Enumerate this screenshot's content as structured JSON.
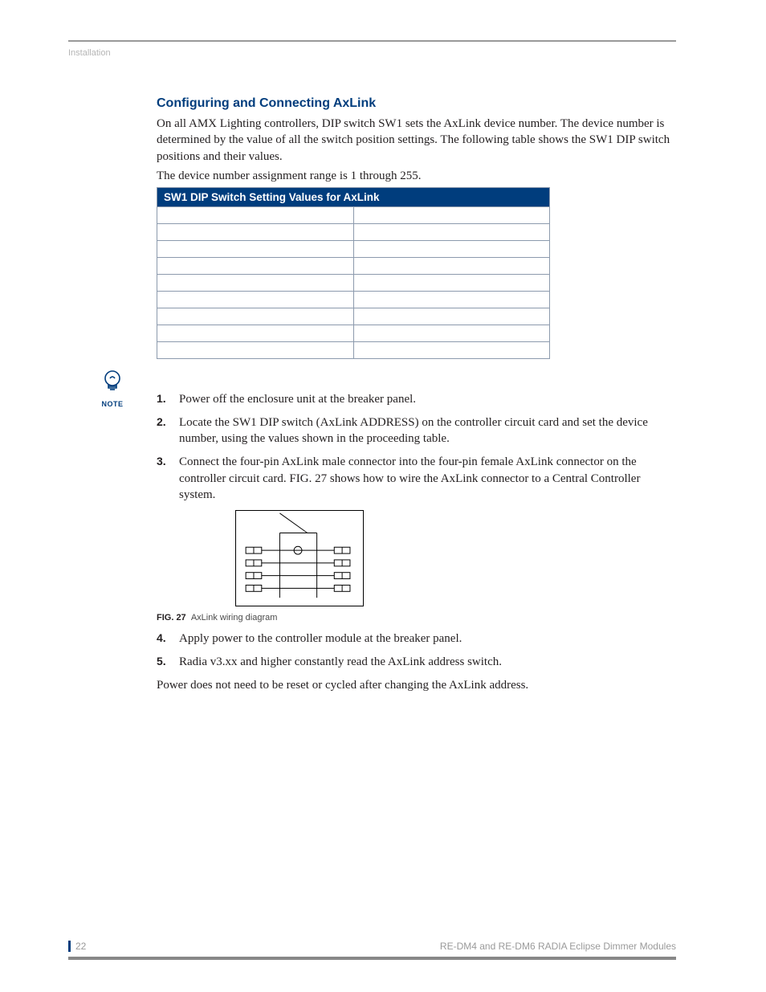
{
  "header": {
    "section_label": "Installation"
  },
  "section": {
    "heading": "Configuring and Connecting AxLink",
    "paragraph1": "On all AMX Lighting controllers, DIP switch SW1 sets the AxLink device number. The device number is determined by the value of all the switch position settings. The following table shows the SW1 DIP switch positions and their values.",
    "paragraph2": "The device number assignment range is 1 through 255."
  },
  "table": {
    "title": "SW1 DIP Switch Setting Values for AxLink",
    "rows": [
      {
        "a": "",
        "b": ""
      },
      {
        "a": "",
        "b": ""
      },
      {
        "a": "",
        "b": ""
      },
      {
        "a": "",
        "b": ""
      },
      {
        "a": "",
        "b": ""
      },
      {
        "a": "",
        "b": ""
      },
      {
        "a": "",
        "b": ""
      },
      {
        "a": "",
        "b": ""
      },
      {
        "a": "",
        "b": ""
      }
    ]
  },
  "note": {
    "label": "NOTE"
  },
  "steps": [
    "Power off the enclosure unit at the breaker panel.",
    "Locate the SW1 DIP switch (AxLink ADDRESS) on the controller circuit card and set the device number, using the values shown in the proceeding table.",
    "Connect the four-pin AxLink male connector into the four-pin female AxLink connector on the controller circuit card. FIG. 27 shows how to wire the AxLink connector to a Central Controller system.",
    "Apply power to the controller module at the breaker panel.",
    "Radia v3.xx and higher constantly read the AxLink address switch."
  ],
  "figure": {
    "label": "FIG. 27",
    "caption": "AxLink wiring diagram"
  },
  "closing": "Power does not need to be reset or cycled after changing the AxLink address.",
  "footer": {
    "page_number": "22",
    "doc_title": "RE-DM4 and RE-DM6 RADIA Eclipse Dimmer Modules"
  }
}
